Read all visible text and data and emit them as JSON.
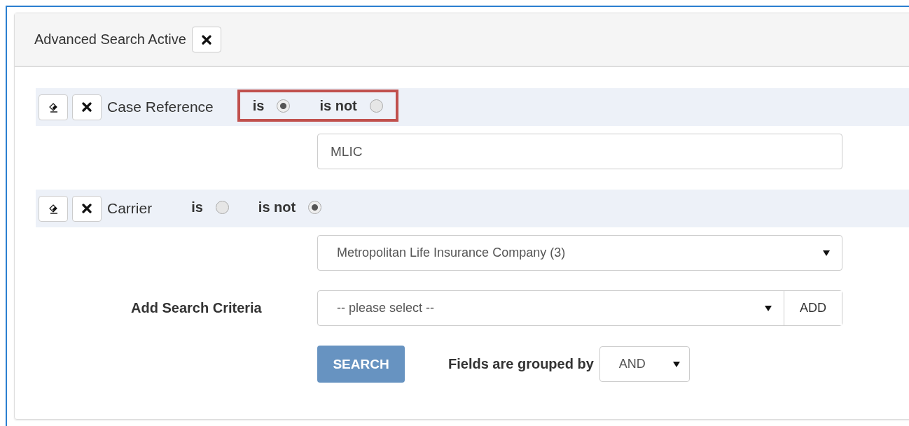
{
  "panel": {
    "title": "Advanced Search Active"
  },
  "criteria": [
    {
      "label": "Case Reference",
      "highlighted": true,
      "options": [
        {
          "label": "is",
          "selected": true
        },
        {
          "label": "is not",
          "selected": false
        }
      ],
      "field": {
        "kind": "text",
        "value": "MLIC"
      }
    },
    {
      "label": "Carrier",
      "highlighted": false,
      "options": [
        {
          "label": "is",
          "selected": false
        },
        {
          "label": "is not",
          "selected": true
        }
      ],
      "field": {
        "kind": "select",
        "value": "Metropolitan Life Insurance Company (3)"
      }
    }
  ],
  "add_criteria": {
    "label": "Add Search Criteria",
    "placeholder": "-- please select --",
    "button": "ADD"
  },
  "search_button": "SEARCH",
  "grouping": {
    "label": "Fields are grouped by",
    "value": "AND"
  }
}
